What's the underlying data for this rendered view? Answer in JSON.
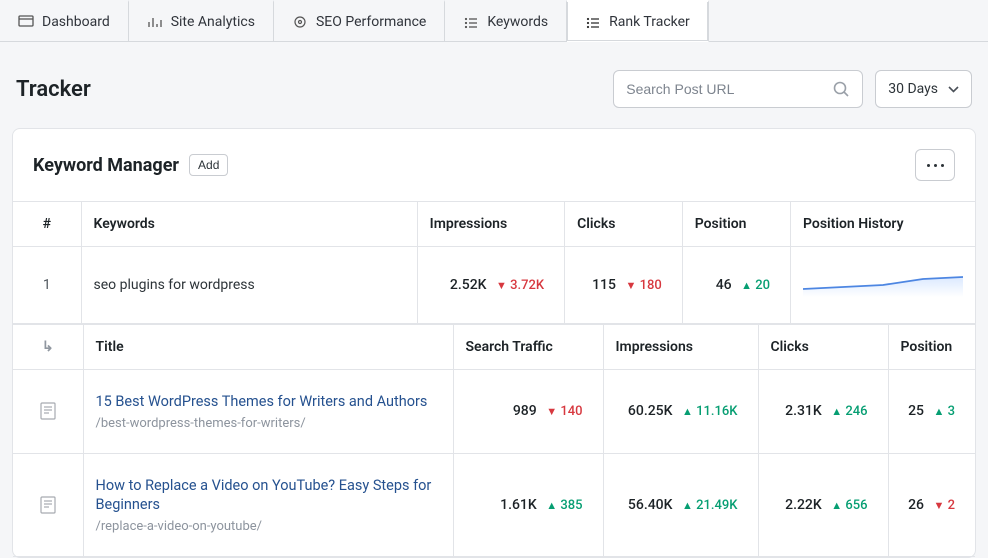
{
  "tabs": [
    {
      "label": "Dashboard",
      "active": false
    },
    {
      "label": "Site Analytics",
      "active": false
    },
    {
      "label": "SEO Performance",
      "active": false
    },
    {
      "label": "Keywords",
      "active": false
    },
    {
      "label": "Rank Tracker",
      "active": true
    }
  ],
  "page_title": "Tracker",
  "search_placeholder": "Search Post URL",
  "days_label": "30 Days",
  "panel": {
    "title": "Keyword Manager",
    "add_label": "Add"
  },
  "keyword_table": {
    "headers": {
      "num": "#",
      "keywords": "Keywords",
      "impressions": "Impressions",
      "clicks": "Clicks",
      "position": "Position",
      "history": "Position History"
    },
    "rows": [
      {
        "num": "1",
        "keyword": "seo plugins for wordpress",
        "impressions": {
          "value": "2.52K",
          "delta": "3.72K",
          "dir": "down"
        },
        "clicks": {
          "value": "115",
          "delta": "180",
          "dir": "down"
        },
        "position": {
          "value": "46",
          "delta": "20",
          "dir": "up"
        }
      }
    ]
  },
  "post_table": {
    "headers": {
      "arrow": "↳",
      "title": "Title",
      "traffic": "Search Traffic",
      "impressions": "Impressions",
      "clicks": "Clicks",
      "position": "Position"
    },
    "rows": [
      {
        "title": "15 Best WordPress Themes for Writers and Authors",
        "url": "/best-wordpress-themes-for-writers/",
        "traffic": {
          "value": "989",
          "delta": "140",
          "dir": "down"
        },
        "impressions": {
          "value": "60.25K",
          "delta": "11.16K",
          "dir": "up"
        },
        "clicks": {
          "value": "2.31K",
          "delta": "246",
          "dir": "up"
        },
        "position": {
          "value": "25",
          "delta": "3",
          "dir": "up"
        }
      },
      {
        "title": "How to Replace a Video on YouTube? Easy Steps for Beginners",
        "url": "/replace-a-video-on-youtube/",
        "traffic": {
          "value": "1.61K",
          "delta": "385",
          "dir": "up"
        },
        "impressions": {
          "value": "56.40K",
          "delta": "21.49K",
          "dir": "up"
        },
        "clicks": {
          "value": "2.22K",
          "delta": "656",
          "dir": "up"
        },
        "position": {
          "value": "26",
          "delta": "2",
          "dir": "down"
        }
      }
    ]
  }
}
